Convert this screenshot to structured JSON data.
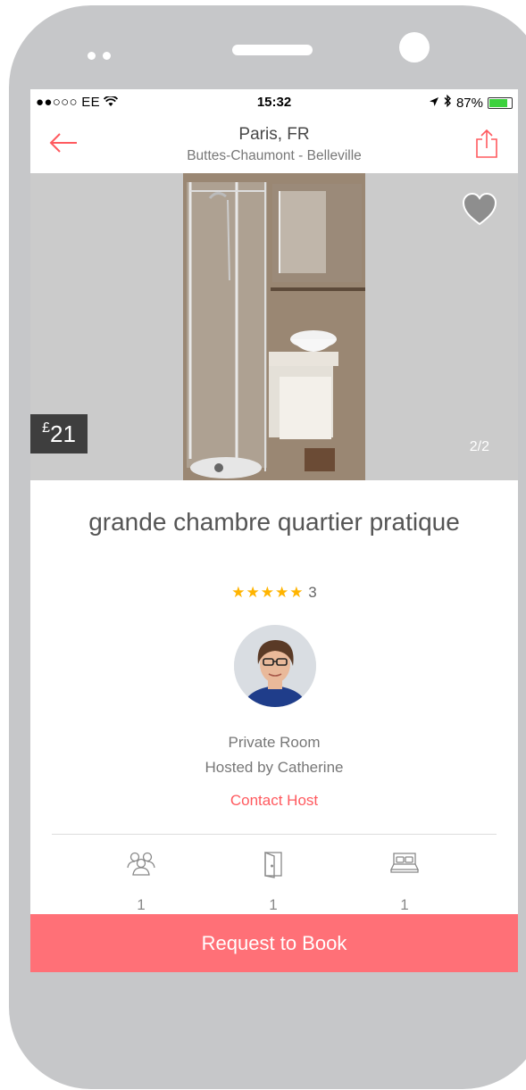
{
  "status_bar": {
    "carrier": "●●○○○ EE",
    "time": "15:32",
    "battery": "87%"
  },
  "nav": {
    "title": "Paris, FR",
    "subtitle": "Buttes-Chaumont - Belleville"
  },
  "photo": {
    "currency": "£",
    "price": "21",
    "counter": "2/2"
  },
  "listing": {
    "title": "grande chambre  quartier pratique",
    "stars": "★★★★★",
    "review_count": "3",
    "room_type": "Private Room",
    "hosted_by": "Hosted by Catherine",
    "contact_label": "Contact Host"
  },
  "amenities": [
    {
      "icon": "guests-icon",
      "count": "1",
      "label": "guest"
    },
    {
      "icon": "door-icon",
      "count": "1",
      "label": "room"
    },
    {
      "icon": "bed-icon",
      "count": "1",
      "label": "bed"
    }
  ],
  "book_button": "Request to Book",
  "colors": {
    "accent": "#ff5a5f",
    "book_button": "#ff7077",
    "star": "#ffb400",
    "phone_frame": "#c6c7c9"
  }
}
